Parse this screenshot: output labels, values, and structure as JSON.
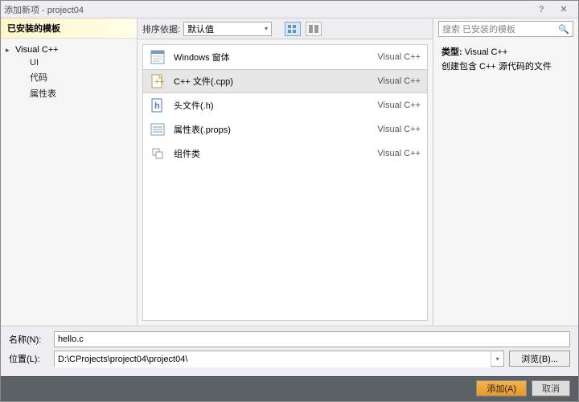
{
  "window": {
    "title": "添加新项 - project04"
  },
  "left": {
    "header": "已安装的模板",
    "tree": {
      "parent": "Visual C++",
      "children": [
        "UI",
        "代码",
        "属性表"
      ]
    }
  },
  "center": {
    "sort_label": "排序依据:",
    "sort_value": "默认值",
    "items": [
      {
        "label": "Windows 窗体",
        "cat": "Visual C++"
      },
      {
        "label": "C++ 文件(.cpp)",
        "cat": "Visual C++"
      },
      {
        "label": "头文件(.h)",
        "cat": "Visual C++"
      },
      {
        "label": "属性表(.props)",
        "cat": "Visual C++"
      },
      {
        "label": "组件类",
        "cat": "Visual C++"
      }
    ],
    "selected_index": 1
  },
  "right": {
    "search_placeholder": "搜索 已安装的模板",
    "type_label": "类型:",
    "type_value": "Visual C++",
    "description": "创建包含 C++ 源代码的文件"
  },
  "bottom": {
    "name_label": "名称(N):",
    "name_value": "hello.c",
    "location_label": "位置(L):",
    "location_value": "D:\\CProjects\\project04\\project04\\",
    "browse": "浏览(B)..."
  },
  "footer": {
    "add": "添加(A)",
    "cancel": "取消"
  }
}
